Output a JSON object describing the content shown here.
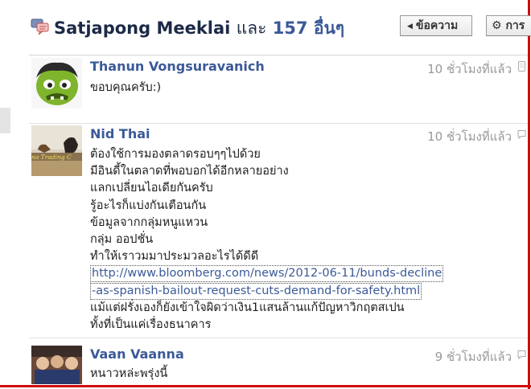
{
  "header": {
    "title_name": "Satjapong Meeklai",
    "title_conj": "และ",
    "title_count": "157 อื่นๆ",
    "message_button": "ข้อความ",
    "settings_button": "การ"
  },
  "messages": [
    {
      "author": "Thanun Vongsuravanich",
      "time": "10 ชั่วโมงที่แล้ว",
      "lines": [
        "ขอบคุณครับ:)"
      ]
    },
    {
      "author": "Nid Thai",
      "time": "10 ชั่วโมงที่แล้ว",
      "avatar_text": "na Trading C",
      "lines": [
        "ต้องใช้การมองตลาดรอบๆๆไปด้วย",
        "มีอินดี้ในตลาดที่พอบอกได้อีกหลายอย่าง",
        "แลกเปลี่ยนไอเดียกันครับ",
        "รู้อะไรก็แบ่งกันเตือนกัน",
        "ข้อมูลจากกลุ่มหนูแหวน",
        "กลุ่ม ออปชั่น",
        "ทำให้เราวมมาประมวลอะไรได้ดีดี"
      ],
      "link_lines": [
        "http://www.bloomberg.com/news/2012-06-11/bunds-decline",
        "-as-spanish-bailout-request-cuts-demand-for-safety.html"
      ],
      "after_lines": [
        "แม้แต่ฝรั่งเองก็ยังเข้าใจผิดว่าเงิน1แสนล้านแก้ปัญหาวิกฤตสเปน",
        "ทั้งที่เป็นแค่เรื่องธนาคาร"
      ]
    },
    {
      "author": "Vaan Vaanna",
      "time": "9 ชั่วโมงที่แล้ว",
      "lines": [
        "หนาวหล่ะพรุ่งนี้"
      ]
    }
  ]
}
